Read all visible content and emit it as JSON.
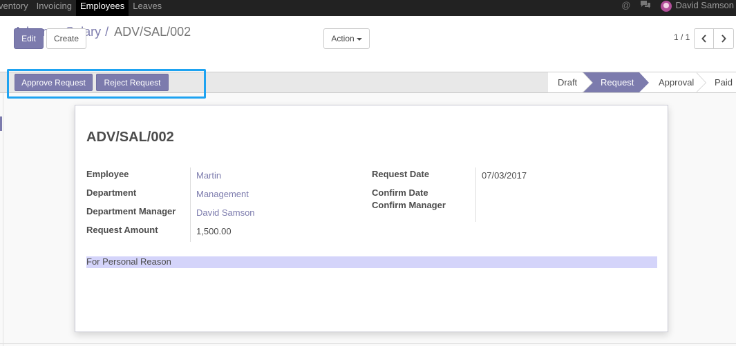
{
  "topbar": {
    "menu": [
      "ventory",
      "Invoicing",
      "Employees",
      "Leaves"
    ],
    "active_index": 2,
    "user": "David Samson",
    "icons": [
      "at-icon",
      "chat-icon"
    ]
  },
  "breadcrumb": {
    "parent": "Advance Salary",
    "separator": "/",
    "current": "ADV/SAL/002"
  },
  "toolbar": {
    "edit_label": "Edit",
    "create_label": "Create",
    "action_label": "Action",
    "pager_text": "1 / 1"
  },
  "statusbar": {
    "approve_label": "Approve Request",
    "reject_label": "Reject Request",
    "stages": [
      "Draft",
      "Request",
      "Approval",
      "Paid"
    ],
    "active_stage": "Request"
  },
  "form": {
    "title": "ADV/SAL/002",
    "left_fields": [
      {
        "label": "Employee",
        "value": "Martin"
      },
      {
        "label": "Department",
        "value": "Management"
      },
      {
        "label": "Department Manager",
        "value": "David Samson"
      },
      {
        "label": "Request Amount",
        "value": "1,500.00"
      }
    ],
    "right_fields": [
      {
        "label": "Request Date",
        "value": "07/03/2017"
      },
      {
        "label": "Confirm Date",
        "value": ""
      },
      {
        "label": "Confirm Manager",
        "value": ""
      }
    ],
    "reason": "For Personal Reason"
  },
  "colors": {
    "primary": "#7c7bad",
    "highlight_box": "#1ea3f1",
    "reason_bg": "#d4d4fa"
  }
}
